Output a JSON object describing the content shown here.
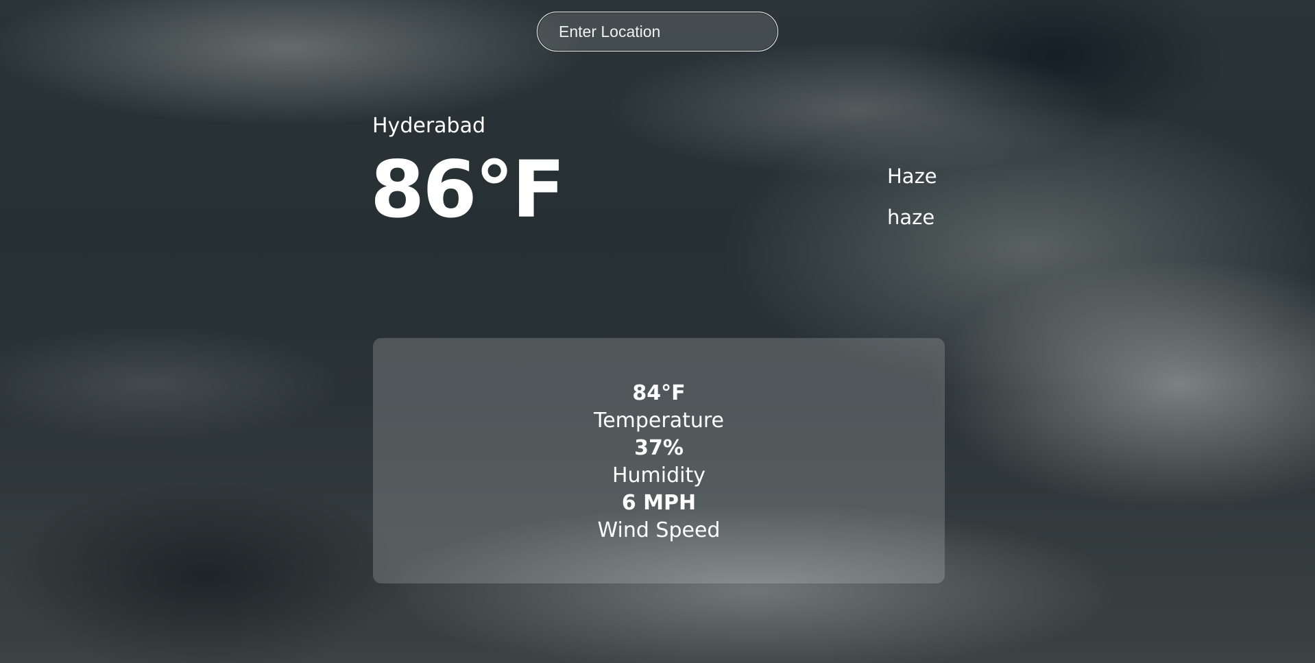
{
  "search": {
    "placeholder": "Enter Location",
    "value": ""
  },
  "location": {
    "city": "Hyderabad"
  },
  "current": {
    "temperature": "86°F",
    "condition_main": "Haze",
    "condition_description": "haze"
  },
  "details": [
    {
      "value": "84°F",
      "label": "Temperature"
    },
    {
      "value": "37%",
      "label": "Humidity"
    },
    {
      "value": "6 MPH",
      "label": "Wind Speed"
    }
  ]
}
